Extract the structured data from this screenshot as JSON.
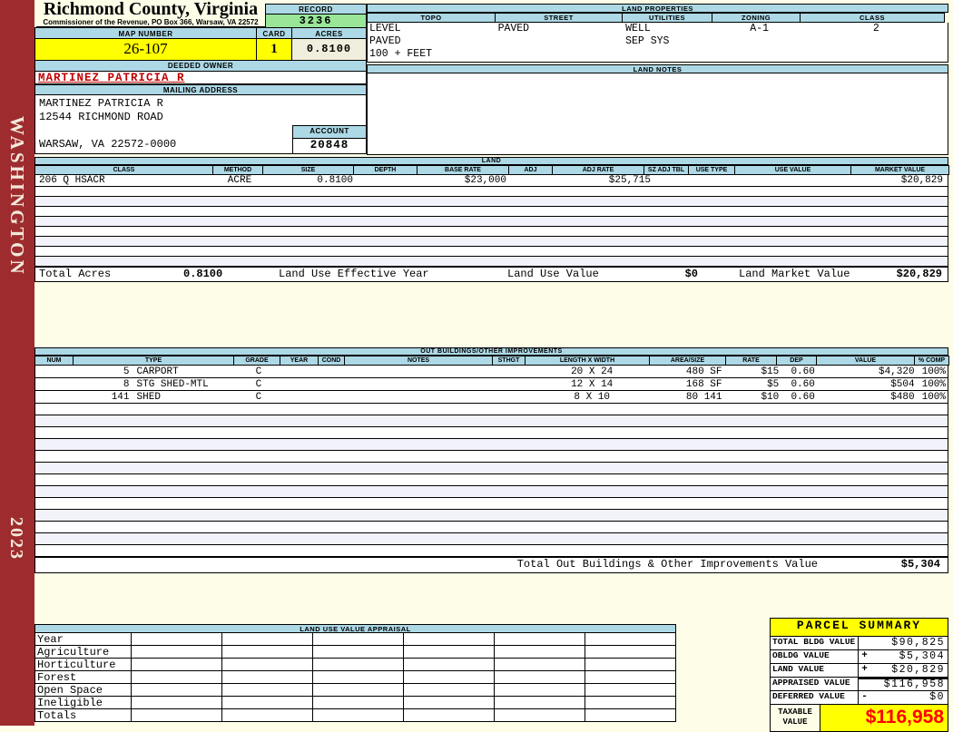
{
  "sidebar": {
    "state": "WASHINGTON",
    "year": "2023",
    "color": "#9E2C2F"
  },
  "header": {
    "county": "Richmond County, Virginia",
    "subtitle": "Commissioner of the Revenue, PO Box 366, Warsaw, VA 22572",
    "record_label": "RECORD",
    "record": "3236",
    "map_number_label": "MAP NUMBER",
    "map_number": "26-107",
    "card_label": "CARD",
    "card": "1",
    "acres_label": "ACRES",
    "acres": "0.8100"
  },
  "owner": {
    "deeded_owner_label": "DEEDED OWNER",
    "name": "MARTINEZ PATRICIA R",
    "mailing_address_label": "MAILING ADDRESS",
    "address_lines": [
      "MARTINEZ PATRICIA R",
      "12544 RICHMOND ROAD",
      "",
      "WARSAW, VA 22572-0000"
    ],
    "account_label": "ACCOUNT",
    "account": "20848"
  },
  "land_properties": {
    "title": "LAND PROPERTIES",
    "columns": [
      "TOPO",
      "STREET",
      "UTILITIES",
      "ZONING",
      "CLASS"
    ],
    "topo": [
      "LEVEL",
      "PAVED",
      "100 + FEET"
    ],
    "street": "PAVED",
    "utilities": [
      "WELL",
      "SEP SYS"
    ],
    "zoning": "A-1",
    "class": "2"
  },
  "land_notes": {
    "title": "LAND NOTES"
  },
  "land": {
    "title": "LAND",
    "columns": [
      "CLASS",
      "METHOD",
      "SIZE",
      "DEPTH",
      "BASE RATE",
      "ADJ",
      "ADJ RATE",
      "SZ ADJ TBL",
      "USE TYPE",
      "USE VALUE",
      "MARKET VALUE"
    ],
    "rows": [
      {
        "class": "206 Q HSACR",
        "method": "ACRE",
        "size": "0.8100",
        "depth": "",
        "base_rate": "$23,000",
        "adj": "",
        "adj_rate": "$25,715",
        "sz_adj_tbl": "",
        "use_type": "",
        "use_value": "",
        "market_value": "$20,829"
      }
    ],
    "totals": {
      "total_acres_label": "Total Acres",
      "total_acres": "0.8100",
      "effective_year_label": "Land Use Effective Year",
      "land_use_value_label": "Land Use Value",
      "land_use_value": "$0",
      "land_market_value_label": "Land Market Value",
      "land_market_value": "$20,829"
    }
  },
  "out_buildings": {
    "title": "OUT BUILDINGS/OTHER IMPROVEMENTS",
    "columns": [
      "NUM",
      "TYPE",
      "GRADE",
      "YEAR",
      "COND",
      "NOTES",
      "STHGT",
      "LENGTH X WIDTH",
      "AREA/SIZE",
      "RATE",
      "DEP",
      "VALUE",
      "% COMP"
    ],
    "rows": [
      {
        "num": "5",
        "type": "CARPORT",
        "grade": "C",
        "year": "",
        "cond": "",
        "notes": "",
        "sthgt": "",
        "lxw": "20 X 24",
        "area": "480 SF",
        "rate": "$15",
        "dep": "0.60",
        "value": "$4,320",
        "comp": "100%"
      },
      {
        "num": "8",
        "type": "STG SHED-MTL",
        "grade": "C",
        "year": "",
        "cond": "",
        "notes": "",
        "sthgt": "",
        "lxw": "12 X 14",
        "area": "168 SF",
        "rate": "$5",
        "dep": "0.60",
        "value": "$504",
        "comp": "100%"
      },
      {
        "num": "141",
        "type": "SHED",
        "grade": "C",
        "year": "",
        "cond": "",
        "notes": "",
        "sthgt": "",
        "lxw": "8 X 10",
        "area": "80 141",
        "rate": "$10",
        "dep": "0.60",
        "value": "$480",
        "comp": "100%"
      }
    ],
    "total_label": "Total Out Buildings & Other Improvements Value",
    "total_value": "$5,304"
  },
  "land_use_appraisal": {
    "title": "LAND USE VALUE APPRAISAL",
    "row_labels": [
      "Year",
      "Agriculture",
      "Horticulture",
      "Forest",
      "Open Space",
      "Ineligible",
      "Totals"
    ]
  },
  "parcel_summary": {
    "title": "PARCEL SUMMARY",
    "rows": [
      {
        "label": "TOTAL BLDG VALUE",
        "op": "",
        "value": "$90,825"
      },
      {
        "label": "OBLDG VALUE",
        "op": "+",
        "value": "$5,304"
      },
      {
        "label": "LAND VALUE",
        "op": "+",
        "value": "$20,829"
      },
      {
        "label": "APPRAISED VALUE",
        "op": "",
        "value": "$116,958"
      },
      {
        "label": "DEFERRED VALUE",
        "op": "-",
        "value": "$0"
      }
    ],
    "taxable_label": [
      "TAXABLE",
      "VALUE"
    ],
    "taxable_value": "$116,958"
  },
  "colors": {
    "sidebar_red": "#9E2C2F",
    "header_blue": "#ADD8E6",
    "record_green": "#99E699",
    "highlight_yellow": "#FFFF00",
    "owner_red": "#C00000",
    "taxable_red": "#FF0000",
    "page_background": "#FDFDE8"
  }
}
